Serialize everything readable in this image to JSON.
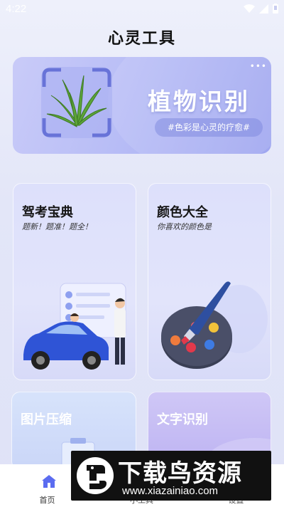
{
  "status_bar": {
    "time": "4:22"
  },
  "app": {
    "title": "心灵工具"
  },
  "banner": {
    "title": "植物识别",
    "tag": "#色彩是心灵的疗愈#",
    "menu_dots": "•••"
  },
  "cards": {
    "driving": {
      "title": "驾考宝典",
      "subtitle": "题新！题准！题全！"
    },
    "color": {
      "title": "颜色大全",
      "subtitle": "你喜欢的颜色是"
    },
    "compress": {
      "title": "图片压缩"
    },
    "ocr": {
      "title": "文字识别"
    }
  },
  "bottom_nav": {
    "items": [
      {
        "label": "首页",
        "icon": "home-icon",
        "active": true
      },
      {
        "label": "小工具",
        "icon": "tools-icon",
        "active": false
      },
      {
        "label": "设置",
        "icon": "settings-icon",
        "active": false
      }
    ]
  },
  "watermark": {
    "title": "下载鸟资源",
    "url": "www.xiazainiao.com"
  },
  "colors": {
    "accent": "#5b6cf0",
    "banner_bg": "#b8bdf6",
    "card_bg": "#dde0fb"
  }
}
